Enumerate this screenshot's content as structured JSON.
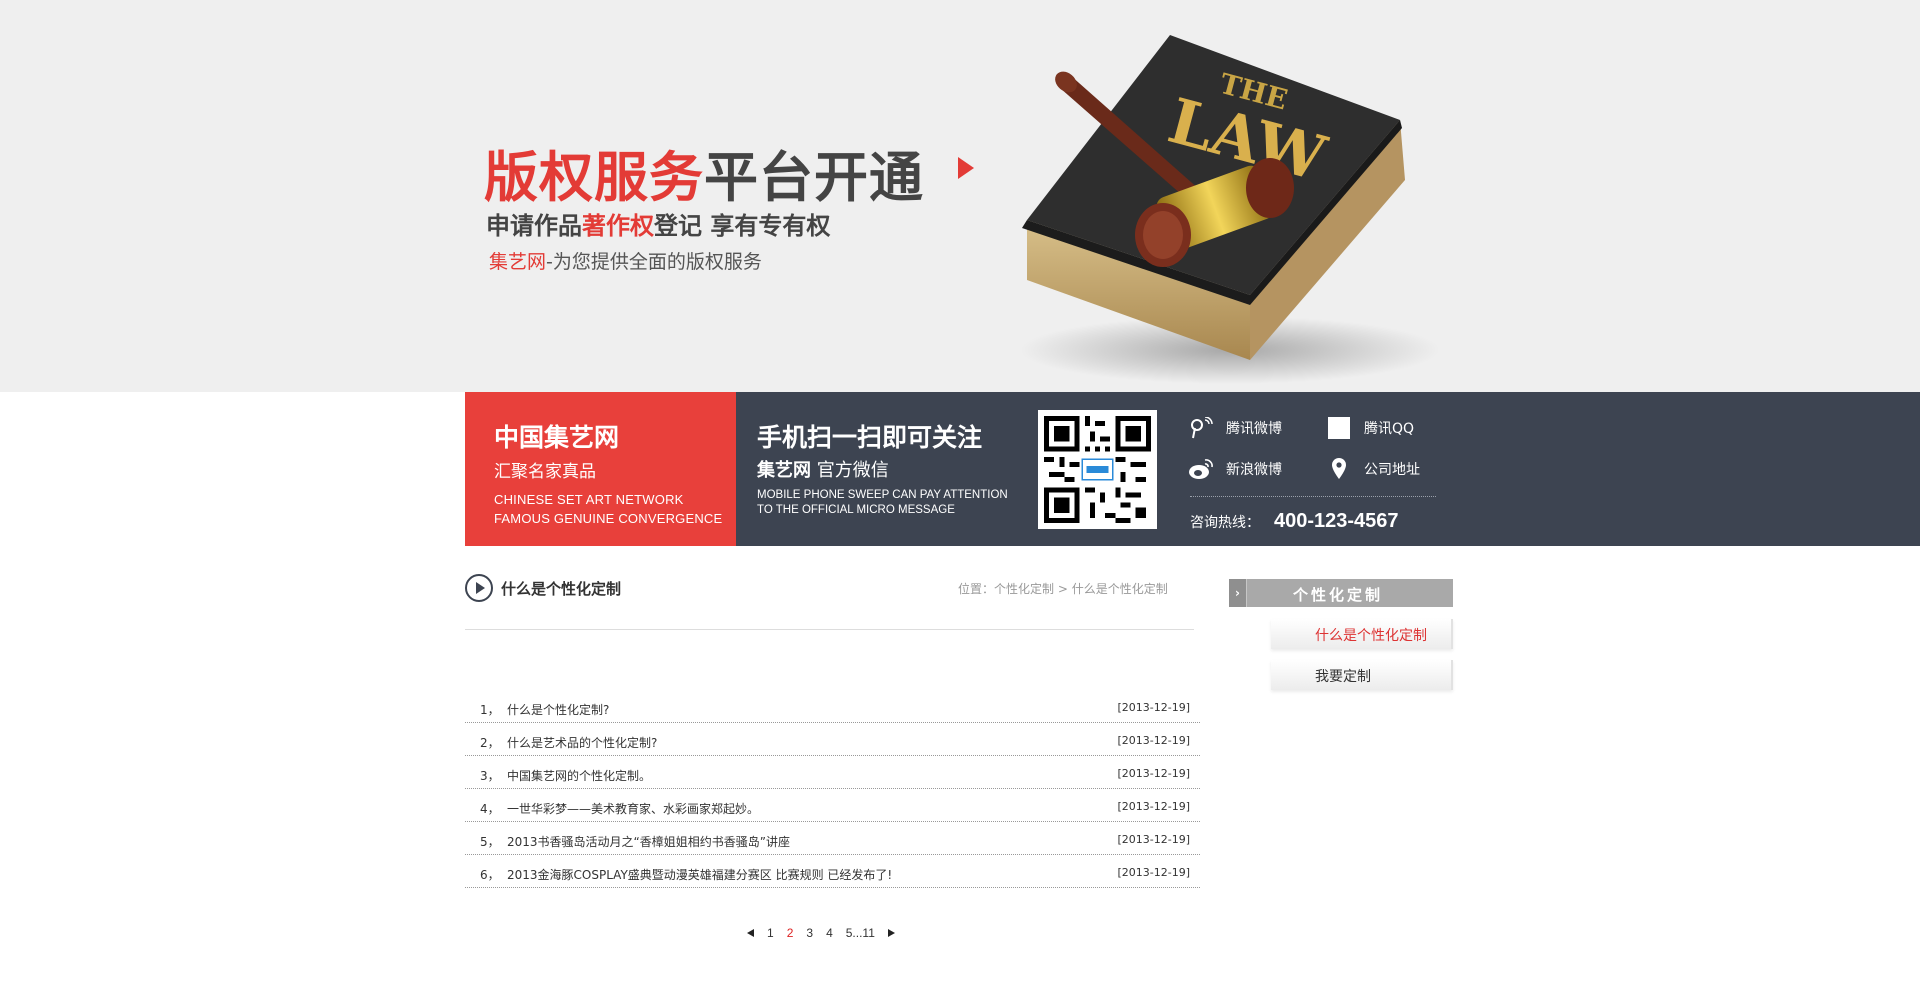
{
  "banner": {
    "title_red": "版权服务",
    "title_dark": "平台开通",
    "sub_prefix": "申请作品",
    "sub_red": "著作权",
    "sub_suffix": "登记 享有专有权",
    "line3_red": "集艺网",
    "line3_rest": "-为您提供全面的版权服务"
  },
  "infobar": {
    "brand": "中国集艺网",
    "brand_slogan": "汇聚名家真品",
    "brand_en_1": "CHINESE SET ART NETWORK",
    "brand_en_2": "FAMOUS GENUINE CONVERGENCE",
    "scan_title": "手机扫一扫即可关注",
    "scan_sub_bold": "集艺网",
    "scan_sub": " 官方微信",
    "scan_en_1": "MOBILE PHONE SWEEP CAN PAY ATTENTION",
    "scan_en_2": "TO THE OFFICIAL MICRO MESSAGE",
    "social": {
      "tencent_weibo": "腾讯微博",
      "tencent_qq": "腾讯QQ",
      "sina_weibo": "新浪微博",
      "address": "公司地址"
    },
    "hotline_label": "咨询热线：",
    "hotline": "400-123-4567"
  },
  "section": {
    "title": "什么是个性化定制",
    "crumb_prefix": "位置：",
    "crumb_1": "个性化定制",
    "crumb_sep": ">",
    "crumb_2": "什么是个性化定制"
  },
  "articles": [
    {
      "idx": "1，",
      "title": "什么是个性化定制?",
      "date": "[2013-12-19]"
    },
    {
      "idx": "2，",
      "title": "什么是艺术品的个性化定制?",
      "date": "[2013-12-19]"
    },
    {
      "idx": "3，",
      "title": "中国集艺网的个性化定制。",
      "date": "[2013-12-19]"
    },
    {
      "idx": "4，",
      "title": "一世华彩梦——美术教育家、水彩画家郑起妙。",
      "date": "[2013-12-19]"
    },
    {
      "idx": "5，",
      "title": "2013书香骚岛活动月之“香樟姐姐相约书香骚岛”讲座",
      "date": "[2013-12-19]"
    },
    {
      "idx": "6，",
      "title": "2013金海豚COSPLAY盛典暨动漫英雄福建分赛区 比赛规则 已经发布了!",
      "date": "[2013-12-19]"
    }
  ],
  "pager": {
    "p1": "1",
    "p2": "2",
    "p3": "3",
    "p4": "4",
    "p5": "5...11"
  },
  "sidebar": {
    "heading": "个性化定制",
    "items": [
      "什么是个性化定制",
      "我要定制"
    ]
  },
  "colors": {
    "accent_red": "#e8403b",
    "bar_dark": "#3d4451",
    "banner_bg": "#efefef"
  }
}
